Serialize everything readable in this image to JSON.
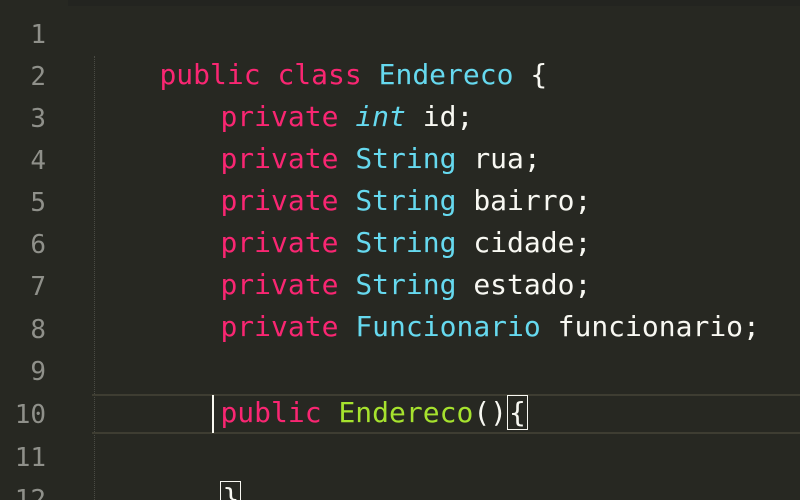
{
  "editor": {
    "line_numbers": [
      "1",
      "2",
      "3",
      "4",
      "5",
      "6",
      "7",
      "8",
      "9",
      "10",
      "11",
      "12"
    ],
    "lines": [
      {
        "t1": "public",
        "t2": " class ",
        "t3": "Endereco",
        "t4": " {"
      },
      {
        "t1": "private",
        "t2": "int",
        "t3": " id;"
      },
      {
        "t1": "private",
        "t2": "String",
        "t3": " rua;"
      },
      {
        "t1": "private",
        "t2": "String",
        "t3": " bairro;"
      },
      {
        "t1": "private",
        "t2": "String",
        "t3": " cidade;"
      },
      {
        "t1": "private",
        "t2": "String",
        "t3": " estado;"
      },
      {
        "t1": "private",
        "t2": "Funcionario",
        "t3": " funcionario;"
      },
      {},
      {
        "t1": "public",
        "t2": "Endereco",
        "t3": "()",
        "t4": "{"
      },
      {},
      {
        "t1": "}"
      }
    ]
  },
  "colors": {
    "background": "#272822",
    "keyword": "#f92672",
    "type": "#66d9ef",
    "function": "#a6e22e",
    "text": "#f8f8f2",
    "line_number": "#8f908a"
  }
}
